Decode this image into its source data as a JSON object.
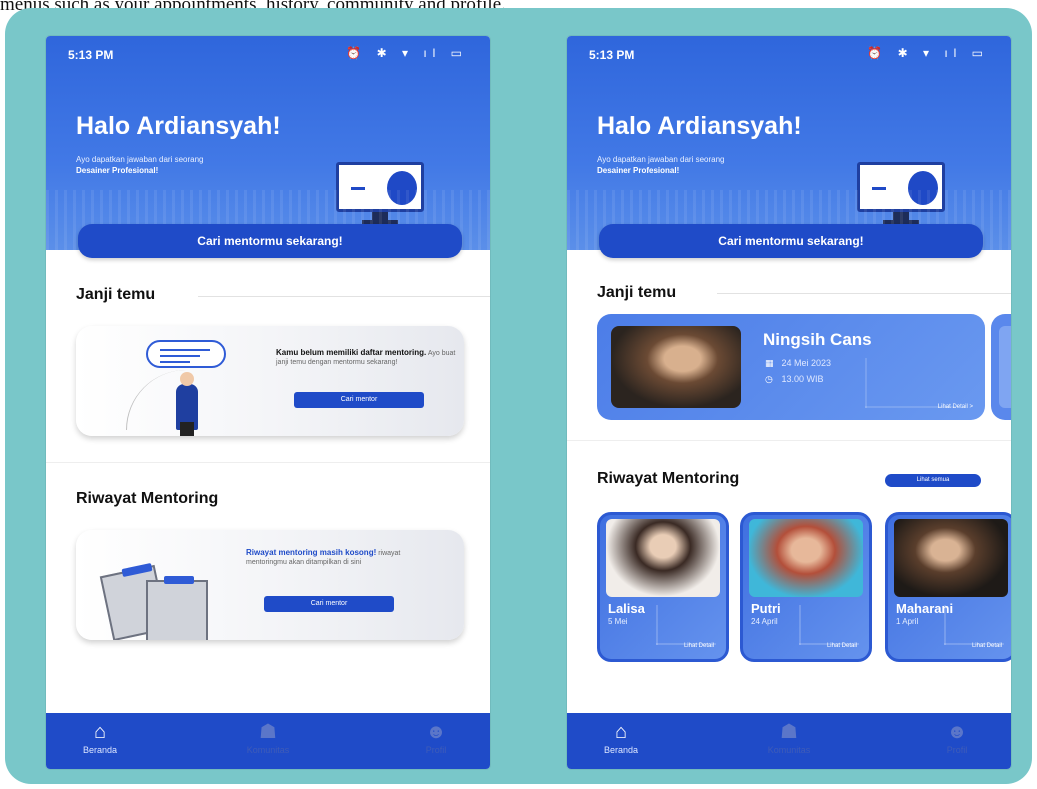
{
  "caption": "menus such as your appointments, history, community and profile.",
  "status": {
    "time": "5:13 PM",
    "icons": "⏰ ✱ ▾ ıl ▭"
  },
  "hero": {
    "title": "Halo Ardiansyah!",
    "subtitle": "Ayo dapatkan jawaban dari seorang",
    "subtitle_bold": "Desainer Profesional!",
    "cta": "Cari mentormu sekarang!"
  },
  "appointments": {
    "title": "Janji temu",
    "empty_bold": "Kamu belum memiliki daftar mentoring.",
    "empty_text": "Ayo buat janji temu dengan mentormu sekarang!",
    "button": "Cari mentor",
    "card": {
      "name": "Ningsih Cans",
      "date": "24 Mei 2023",
      "time": "13.00 WIB",
      "link": "Lihat Detail >",
      "date_icon": "▦",
      "time_icon": "◷"
    }
  },
  "history": {
    "title": "Riwayat Mentoring",
    "empty_bold": "Riwayat mentoring masih kosong!",
    "empty_text": "riwayat mentoringmu akan ditampilkan di sini",
    "button": "Cari mentor",
    "see_all": "Lihat semua",
    "items": [
      {
        "name": "Lalisa",
        "date": "5 Mei",
        "link": "Lihat Detail"
      },
      {
        "name": "Putri",
        "date": "24 April",
        "link": "Lihat Detail"
      },
      {
        "name": "Maharani",
        "date": "1 April",
        "link": "Lihat Detail"
      }
    ]
  },
  "nav": [
    {
      "label": "Beranda",
      "icon": "⌂",
      "active": true
    },
    {
      "label": "Komunitas",
      "icon": "☗",
      "active": false
    },
    {
      "label": "Profil",
      "icon": "☻",
      "active": false
    }
  ],
  "colors": {
    "primary": "#1f4bc8",
    "background_frame": "#79c7c9",
    "card_blue": "#4c7de8"
  }
}
